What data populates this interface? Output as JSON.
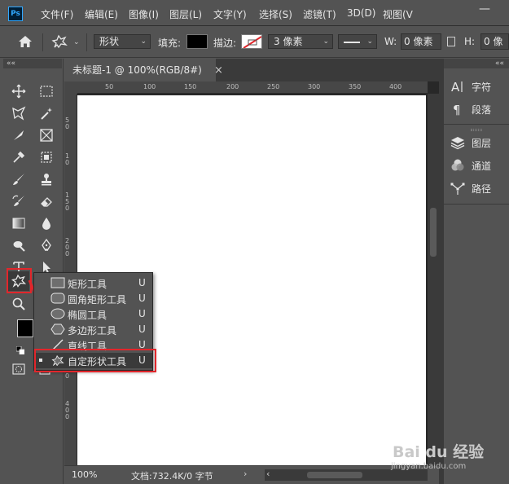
{
  "menubar": {
    "logo": "Ps",
    "items": [
      "文件(F)",
      "编辑(E)",
      "图像(I)",
      "图层(L)",
      "文字(Y)",
      "选择(S)",
      "滤镜(T)",
      "3D(D)",
      "视图(V"
    ],
    "minimize": "—"
  },
  "options": {
    "mode_select": "形状",
    "fill_label": "填充:",
    "stroke_label": "描边:",
    "stroke_width": "3 像素",
    "w_label": "W:",
    "w_value": "0 像素",
    "h_label": "H:",
    "h_value": "0 像"
  },
  "toolbar": {
    "collapse": "««"
  },
  "document": {
    "tab_title": "未标题-1 @ 100%(RGB/8#)",
    "tab_close": "×",
    "ruler_h": [
      "50",
      "100",
      "150",
      "200",
      "250",
      "300",
      "350",
      "400"
    ],
    "ruler_v": [
      "5",
      "0",
      "1",
      "0",
      "1",
      "5",
      "0",
      "2",
      "0",
      "0",
      "2",
      "5",
      "0",
      "3",
      "0",
      "0",
      "3",
      "5",
      "0",
      "4",
      "0",
      "0"
    ],
    "zoom": "100%",
    "doc_info": "文档:732.4K/0 字节",
    "status_chevron": "›",
    "hscroll_left": "‹"
  },
  "flyout": {
    "items": [
      {
        "label": "矩形工具",
        "key": "U"
      },
      {
        "label": "圆角矩形工具",
        "key": "U"
      },
      {
        "label": "椭圆工具",
        "key": "U"
      },
      {
        "label": "多边形工具",
        "key": "U"
      },
      {
        "label": "直线工具",
        "key": "U"
      },
      {
        "label": "自定形状工具",
        "key": "U"
      }
    ]
  },
  "panels": {
    "collapse": "««",
    "group1": [
      {
        "label": "字符",
        "icon": "character-icon"
      },
      {
        "label": "段落",
        "icon": "paragraph-icon"
      }
    ],
    "group2": [
      {
        "label": "图层",
        "icon": "layers-icon"
      },
      {
        "label": "通道",
        "icon": "channels-icon"
      },
      {
        "label": "路径",
        "icon": "paths-icon"
      }
    ]
  },
  "watermark": {
    "brand": "Bai du 经验",
    "url": "jingyan.baidu.com"
  },
  "colors": {
    "highlight_red": "#e2262b",
    "canvas": "#ffffff",
    "ui_bg": "#535353"
  }
}
